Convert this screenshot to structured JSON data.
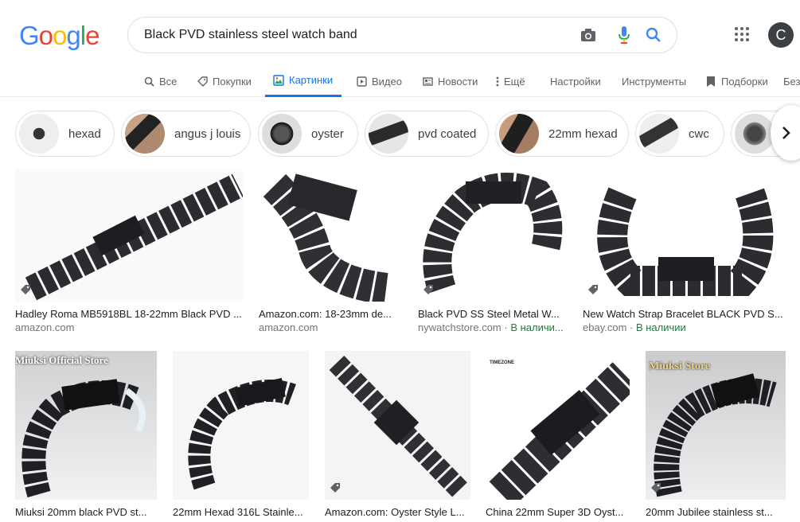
{
  "search": {
    "query": "Black PVD stainless steel watch band"
  },
  "user": {
    "initial": "C"
  },
  "tabs": [
    {
      "label": "Все",
      "icon": "search-icon"
    },
    {
      "label": "Покупки",
      "icon": "tag-icon"
    },
    {
      "label": "Картинки",
      "icon": "image-icon"
    },
    {
      "label": "Видео",
      "icon": "play-icon"
    },
    {
      "label": "Новости",
      "icon": "news-icon"
    },
    {
      "label": "Ещё",
      "icon": "more-vert-icon"
    },
    {
      "label": "Настройки"
    },
    {
      "label": "Инструменты"
    },
    {
      "label": "Подборки",
      "icon": "bookmark-icon"
    },
    {
      "label": "Без"
    }
  ],
  "chips": [
    {
      "label": "hexad"
    },
    {
      "label": "angus j louis"
    },
    {
      "label": "oyster"
    },
    {
      "label": "pvd coated"
    },
    {
      "label": "22mm hexad"
    },
    {
      "label": "cwc"
    },
    {
      "label": ""
    }
  ],
  "results_row1": [
    {
      "title": "Hadley Roma MB5918BL 18-22mm Black PVD ...",
      "source": "amazon.com",
      "stock": ""
    },
    {
      "title": "Amazon.com: 18-23mm de...",
      "source": "amazon.com",
      "stock": ""
    },
    {
      "title": "Black PVD SS Steel Metal W...",
      "source": "nywatchstore.com",
      "stock": "В наличи..."
    },
    {
      "title": "New Watch Strap Bracelet BLACK PVD S...",
      "source": "ebay.com",
      "stock": "В наличии"
    }
  ],
  "results_row2": [
    {
      "title": "Miuksi 20mm black PVD st...",
      "overlay": "Miuksi Official Store"
    },
    {
      "title": "22mm Hexad 316L Stainle..."
    },
    {
      "title": "Amazon.com: Oyster Style L..."
    },
    {
      "title": "China 22mm Super 3D Oyst...",
      "overlay": "TIMEZONE"
    },
    {
      "title": "20mm Jubilee stainless st...",
      "overlay": "Miuksi Store"
    }
  ],
  "colors": {
    "accent": "#1a73e8",
    "in_stock": "#188038",
    "text_secondary": "#70757a"
  }
}
